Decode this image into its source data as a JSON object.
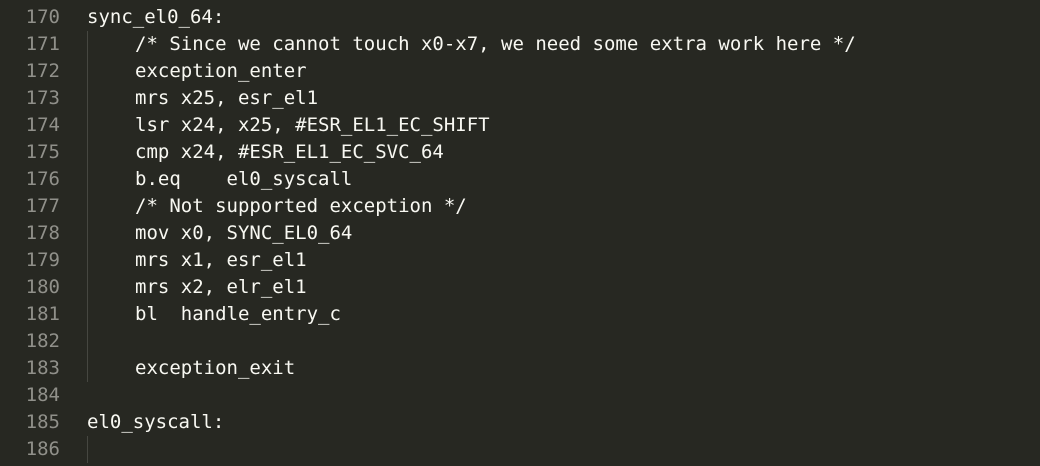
{
  "editor": {
    "lines": [
      {
        "number": "170",
        "code": "sync_el0_64:",
        "indent": 0
      },
      {
        "number": "171",
        "code": "/* Since we cannot touch x0-x7, we need some extra work here */",
        "indent": 1
      },
      {
        "number": "172",
        "code": "exception_enter",
        "indent": 1
      },
      {
        "number": "173",
        "code": "mrs x25, esr_el1",
        "indent": 1
      },
      {
        "number": "174",
        "code": "lsr x24, x25, #ESR_EL1_EC_SHIFT",
        "indent": 1
      },
      {
        "number": "175",
        "code": "cmp x24, #ESR_EL1_EC_SVC_64",
        "indent": 1
      },
      {
        "number": "176",
        "code": "b.eq    el0_syscall",
        "indent": 1
      },
      {
        "number": "177",
        "code": "/* Not supported exception */",
        "indent": 1
      },
      {
        "number": "178",
        "code": "mov x0, SYNC_EL0_64",
        "indent": 1
      },
      {
        "number": "179",
        "code": "mrs x1, esr_el1",
        "indent": 1
      },
      {
        "number": "180",
        "code": "mrs x2, elr_el1",
        "indent": 1
      },
      {
        "number": "181",
        "code": "bl  handle_entry_c",
        "indent": 1
      },
      {
        "number": "182",
        "code": "",
        "indent": 1
      },
      {
        "number": "183",
        "code": "exception_exit",
        "indent": 1
      },
      {
        "number": "184",
        "code": "",
        "indent": 0
      },
      {
        "number": "185",
        "code": "el0_syscall:",
        "indent": 0
      },
      {
        "number": "186",
        "code": "",
        "indent": 1
      }
    ]
  }
}
